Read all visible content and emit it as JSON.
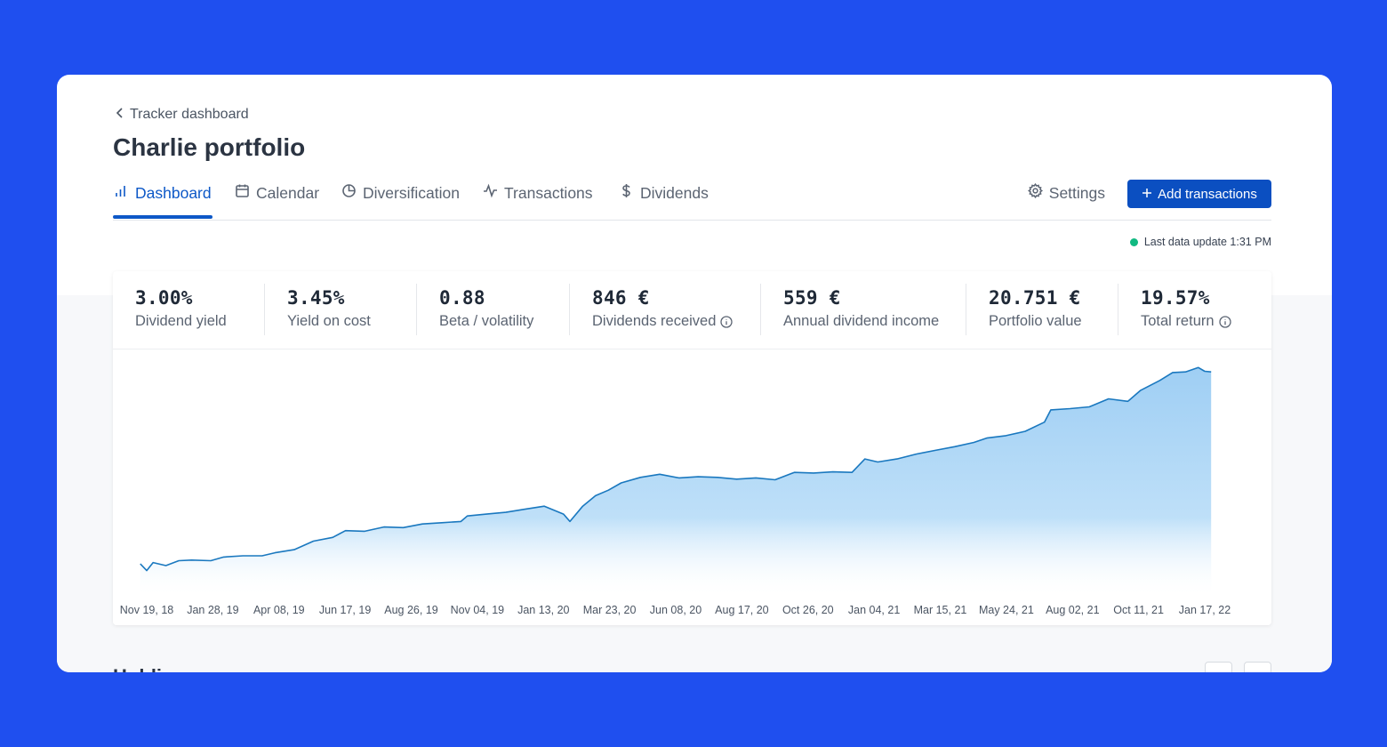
{
  "breadcrumb": {
    "label": "Tracker dashboard"
  },
  "page": {
    "title": "Charlie portfolio"
  },
  "tabs": [
    {
      "label": "Dashboard",
      "icon": "bar-chart-icon",
      "active": true
    },
    {
      "label": "Calendar",
      "icon": "calendar-icon"
    },
    {
      "label": "Diversification",
      "icon": "pie-chart-icon"
    },
    {
      "label": "Transactions",
      "icon": "activity-icon"
    },
    {
      "label": "Dividends",
      "icon": "dollar-icon"
    }
  ],
  "toolbar": {
    "settings_label": "Settings",
    "add_label": "Add transactions"
  },
  "status": {
    "update_text": "Last data update 1:31 PM",
    "color": "#10b981"
  },
  "stats": [
    {
      "value": "3.00%",
      "label": "Dividend yield"
    },
    {
      "value": "3.45%",
      "label": "Yield on cost"
    },
    {
      "value": "0.88",
      "label": "Beta / volatility"
    },
    {
      "value": "846 €",
      "label": "Dividends received",
      "info": true
    },
    {
      "value": "559 €",
      "label": "Annual dividend income"
    },
    {
      "value": "20.751 €",
      "label": "Portfolio value"
    },
    {
      "value": "19.57%",
      "label": "Total return",
      "info": true
    }
  ],
  "colors": {
    "accent": "#0d58c7",
    "button": "#0b4fc1",
    "background": "#1f4fef",
    "line": "#1a78bf",
    "area": "#a9d3f5"
  },
  "chart_data": {
    "type": "area",
    "x_tick_labels": [
      "Nov 19, 18",
      "Jan 28, 19",
      "Apr 08, 19",
      "Jun 17, 19",
      "Aug 26, 19",
      "Nov 04, 19",
      "Jan 13, 20",
      "Mar 23, 20",
      "Jun 08, 20",
      "Aug 17, 20",
      "Oct 26, 20",
      "Jan 04, 21",
      "Mar 15, 21",
      "May 24, 21",
      "Aug 02, 21",
      "Oct 11, 21",
      "Jan 17, 22"
    ],
    "x": [
      "2018-11-12",
      "2018-11-19",
      "2018-11-26",
      "2018-12-10",
      "2018-12-24",
      "2019-01-07",
      "2019-01-28",
      "2019-02-11",
      "2019-03-04",
      "2019-03-25",
      "2019-04-08",
      "2019-04-29",
      "2019-05-20",
      "2019-06-10",
      "2019-06-24",
      "2019-07-15",
      "2019-08-05",
      "2019-08-26",
      "2019-09-16",
      "2019-10-07",
      "2019-10-28",
      "2019-11-04",
      "2019-11-25",
      "2019-12-16",
      "2020-01-06",
      "2020-01-27",
      "2020-02-17",
      "2020-02-24",
      "2020-03-09",
      "2020-03-23",
      "2020-04-06",
      "2020-04-20",
      "2020-05-11",
      "2020-06-01",
      "2020-06-22",
      "2020-07-13",
      "2020-08-03",
      "2020-08-24",
      "2020-09-14",
      "2020-10-05",
      "2020-10-26",
      "2020-11-16",
      "2020-12-07",
      "2020-12-28",
      "2021-01-11",
      "2021-01-25",
      "2021-02-15",
      "2021-03-08",
      "2021-03-29",
      "2021-04-19",
      "2021-05-10",
      "2021-05-24",
      "2021-06-14",
      "2021-07-05",
      "2021-07-26",
      "2021-08-02",
      "2021-08-23",
      "2021-09-13",
      "2021-10-04",
      "2021-10-25",
      "2021-11-08",
      "2021-11-29",
      "2021-12-13",
      "2021-12-27",
      "2022-01-10",
      "2022-01-17",
      "2022-01-24"
    ],
    "values": [
      0.5,
      -0.6,
      0.7,
      0.2,
      1.0,
      1.1,
      1.0,
      1.6,
      1.8,
      1.8,
      2.3,
      2.8,
      4.2,
      4.8,
      5.9,
      5.8,
      6.5,
      6.4,
      7.0,
      7.2,
      7.4,
      8.3,
      8.6,
      8.9,
      9.4,
      9.9,
      8.6,
      7.4,
      9.9,
      11.6,
      12.5,
      13.7,
      14.6,
      15.1,
      14.5,
      14.7,
      14.6,
      14.3,
      14.5,
      14.2,
      15.4,
      15.3,
      15.5,
      15.4,
      17.6,
      17.1,
      17.6,
      18.4,
      19.0,
      19.6,
      20.3,
      21.0,
      21.4,
      22.1,
      23.6,
      25.6,
      25.8,
      26.1,
      27.4,
      27.0,
      28.8,
      30.4,
      31.7,
      31.8,
      32.5,
      31.9,
      31.8
    ],
    "title": "",
    "xlabel": "",
    "ylabel": "",
    "grid": false
  },
  "holdings": {
    "title": "Holdings"
  }
}
